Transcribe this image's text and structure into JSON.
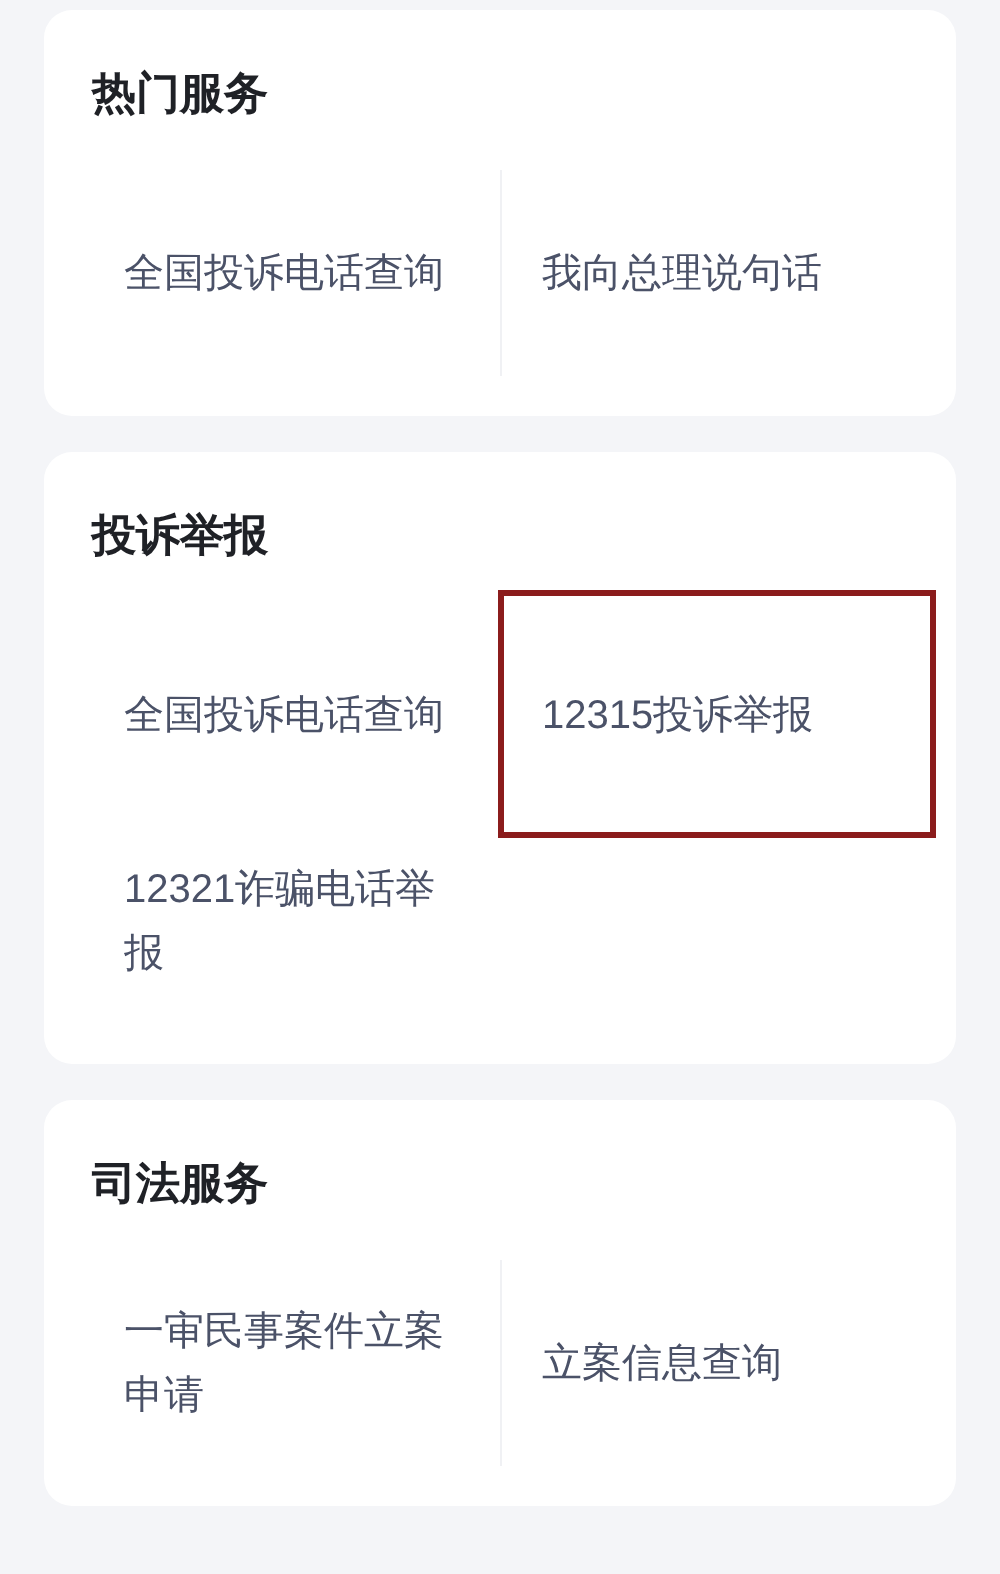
{
  "sections": [
    {
      "title": "热门服务",
      "items": [
        {
          "label": "全国投诉电话查询",
          "highlighted": false
        },
        {
          "label": "我向总理说句话",
          "highlighted": false
        }
      ]
    },
    {
      "title": "投诉举报",
      "items": [
        {
          "label": "全国投诉电话查询",
          "highlighted": false
        },
        {
          "label": "12315投诉举报",
          "highlighted": true
        },
        {
          "label": "12321诈骗电话举报",
          "highlighted": false
        }
      ]
    },
    {
      "title": "司法服务",
      "items": [
        {
          "label": "一审民事案件立案申请",
          "highlighted": false
        },
        {
          "label": "立案信息查询",
          "highlighted": false
        }
      ]
    }
  ]
}
